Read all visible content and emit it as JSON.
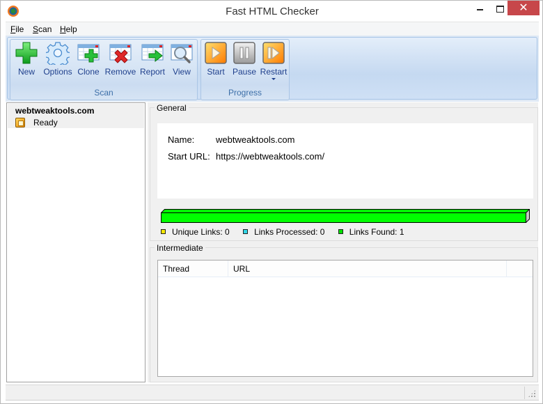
{
  "window": {
    "title": "Fast HTML Checker",
    "controls": {
      "minimize": "minimize",
      "maximize": "maximize",
      "close": "✕"
    }
  },
  "menu": [
    {
      "label": "File",
      "accel": "F",
      "rest": "ile"
    },
    {
      "label": "Scan",
      "accel": "S",
      "rest": "can"
    },
    {
      "label": "Help",
      "accel": "H",
      "rest": "elp"
    }
  ],
  "ribbon": {
    "groups": [
      {
        "label": "Scan",
        "buttons": [
          {
            "label": "New",
            "icon": "plus-icon"
          },
          {
            "label": "Options",
            "icon": "gear-icon"
          },
          {
            "label": "Clone",
            "icon": "table-add-icon"
          },
          {
            "label": "Remove",
            "icon": "table-remove-icon"
          },
          {
            "label": "Report",
            "icon": "table-export-icon"
          },
          {
            "label": "View",
            "icon": "magnifier-icon"
          }
        ]
      },
      {
        "label": "Progress",
        "buttons": [
          {
            "label": "Start",
            "icon": "play-icon"
          },
          {
            "label": "Pause",
            "icon": "pause-icon"
          },
          {
            "label": "Restart",
            "icon": "restart-icon",
            "dropdown": true
          }
        ]
      }
    ]
  },
  "projects": [
    {
      "name": "webtweaktools.com",
      "status": "Ready"
    }
  ],
  "general": {
    "legend": "General",
    "name_label": "Name:",
    "name_value": "webtweaktools.com",
    "url_label": "Start URL:",
    "url_value": "https://webtweaktools.com/",
    "progress_fraction": 1.0,
    "stats": [
      {
        "label": "Unique Links: 0",
        "color": "#f5e600"
      },
      {
        "label": "Links Processed: 0",
        "color": "#33d6e6"
      },
      {
        "label": "Links Found: 1",
        "color": "#00e000"
      }
    ]
  },
  "intermediate": {
    "legend": "Intermediate",
    "columns": [
      "Thread",
      "URL",
      ""
    ],
    "rows": []
  },
  "colors": {
    "progress_fill": "#00ff00",
    "close_button": "#c7474a",
    "ribbon_text": "#1e3f8c",
    "group_label": "#3d6fa8"
  }
}
